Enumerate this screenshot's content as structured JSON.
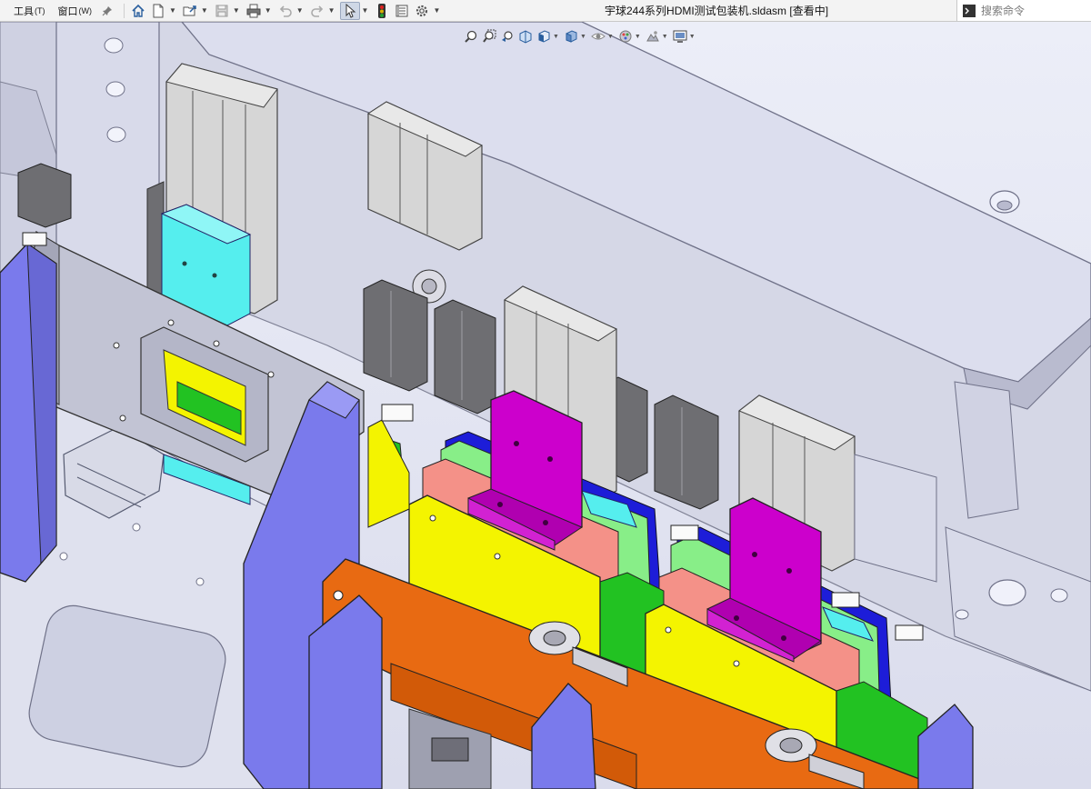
{
  "menu": {
    "items": [
      {
        "label": "工具",
        "accel": "(T)"
      },
      {
        "label": "窗口",
        "accel": "(W)"
      }
    ]
  },
  "toolbar": {
    "buttons": [
      "home-icon",
      "new-document-icon",
      "open-file-icon",
      "save-icon",
      "print-icon",
      "undo-icon",
      "redo-icon",
      "select-cursor-icon",
      "rebuild-traffic-light-icon",
      "file-properties-icon",
      "options-gear-icon"
    ]
  },
  "document": {
    "title": "宇球244系列HDMI测试包装机.sldasm [查看中]"
  },
  "search": {
    "placeholder": "搜索命令"
  },
  "headsup": {
    "buttons": [
      "zoom-to-fit-icon",
      "zoom-to-area-icon",
      "previous-view-icon",
      "section-view-icon",
      "view-orientation-icon",
      "display-style-icon",
      "hide-show-items-icon",
      "edit-appearance-icon",
      "apply-scene-icon",
      "view-settings-icon"
    ]
  },
  "colors": {
    "background": "#e6e8f4",
    "plate_grey": "#c2c4d4",
    "purple_plate": "#7a7aec",
    "orange_plate": "#e86a12",
    "yellow_block": "#f4f400",
    "magenta_bracket": "#cc00cc",
    "cyan_block": "#55eeee",
    "salmon_block": "#f49188",
    "green_block": "#22c222",
    "light_green_block": "#88ee88",
    "blue_strip": "#1d1dd8",
    "cylinder_grey": "#d6d6d6",
    "gripper_dark": "#6e6e72"
  }
}
